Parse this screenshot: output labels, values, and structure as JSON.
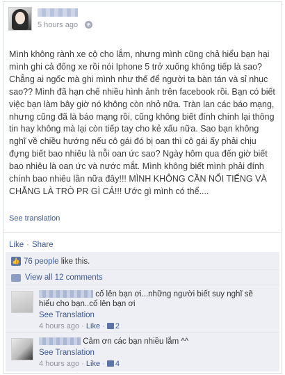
{
  "post": {
    "time": "5 hours ago",
    "text": "Mình không rành xe cộ cho lắm, nhưng mình cũng chả hiểu bạn hại mình ghi cả đống xe rồi nói Iphone 5 trở xuống không tiếp là sao? Chẳng ai ngốc mà ghi mình như thế để người ta bàn tán và sỉ nhục sao?? Mình đã hạn chế nhiều hình ảnh trên facebook rồi. Bạn có biết việc bạn làm bây giờ nó không còn nhỏ nữa. Tràn lan các báo mạng, nhưng cũng đã là báo mạng rồi, cũng không biết đính chính lại thông tin hay không mà lại còn tiếp tay cho kẻ xấu nữa. Sao bạn không nghĩ về chiều hướng nếu cô gái đó bị oan thì cô gái ấy phải chịu đựng biết bao nhiêu là nỗi oan ức sao? Ngày hôm qua đến giờ biết bao nhiêu là oan ức và nước mắt. Mình không biết mình phải đính chính bao nhiêu lần nữa đây!!! MÌNH KHÔNG CẦN NỔI TIẾNG VÀ CHẲNG LÀ TRÒ PR GÌ CẢ!!! Ước gì mình có thể....",
    "see_translation": "See translation"
  },
  "actions": {
    "like": "Like",
    "share": "Share",
    "separator": "·"
  },
  "likes": {
    "count_link": "76 people",
    "suffix": " like this."
  },
  "view_all": "View all 12 comments",
  "comments": [
    {
      "text": "cố lên bạn ơi...những người biết suy nghĩ sẽ hiểu cho bạn..cố lên bạn ơi",
      "see_translation": "See Translation",
      "time": "4 hours ago",
      "like_label": "Like",
      "like_count": "2"
    },
    {
      "text": "Cảm ơn các bạn nhiều lắm ^^",
      "see_translation": "See Translation",
      "time": "4 hours ago",
      "like_label": "Like",
      "like_count": "4"
    }
  ]
}
